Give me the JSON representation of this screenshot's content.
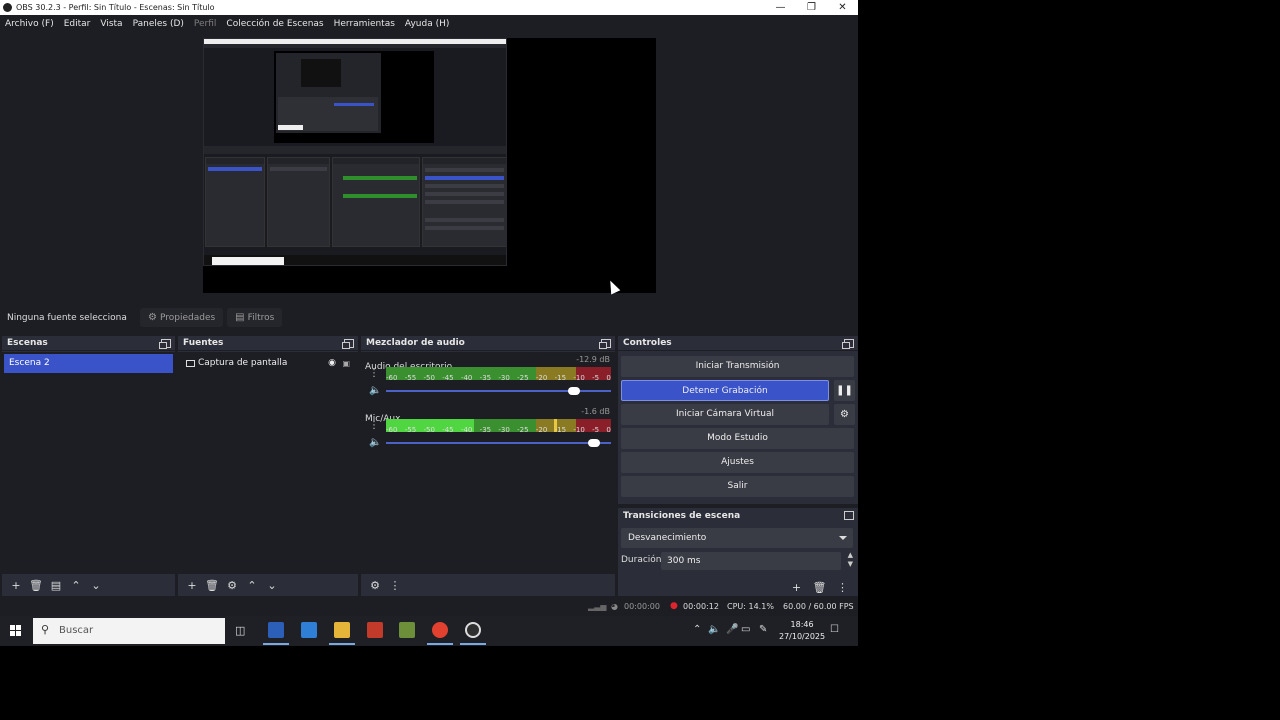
{
  "window": {
    "title": "OBS 30.2.3 - Perfil: Sin Título - Escenas: Sin Título"
  },
  "menu": [
    "Archivo (F)",
    "Editar",
    "Vista",
    "Paneles (D)",
    "Perfil",
    "Colección de Escenas",
    "Herramientas",
    "Ayuda (H)"
  ],
  "source_toolbar": {
    "no_selection": "Ninguna fuente selecciona",
    "properties": "Propiedades",
    "filters": "Filtros"
  },
  "scenes": {
    "title": "Escenas",
    "items": [
      "Escena 2"
    ]
  },
  "sources": {
    "title": "Fuentes",
    "items": [
      "Captura de pantalla"
    ]
  },
  "mixer": {
    "title": "Mezclador de audio",
    "ticks": [
      "-60",
      "-55",
      "-50",
      "-45",
      "-40",
      "-35",
      "-30",
      "-25",
      "-20",
      "-15",
      "-10",
      "-5",
      "0"
    ],
    "channels": [
      {
        "name": "Audio del escritorio",
        "db": "-12.9 dB",
        "volume": 0.86
      },
      {
        "name": "Mic/Aux",
        "db": "-1.6 dB",
        "volume": 0.95
      }
    ]
  },
  "controls": {
    "title": "Controles",
    "start_stream": "Iniciar Transmisión",
    "stop_recording": "Detener Grabación",
    "start_virtual_cam": "Iniciar Cámara Virtual",
    "studio_mode": "Modo Estudio",
    "settings": "Ajustes",
    "exit": "Salir"
  },
  "transitions": {
    "title": "Transiciones de escena",
    "selected": "Desvanecimiento",
    "duration_label": "Duración",
    "duration_value": "300 ms"
  },
  "status": {
    "stream_time": "00:00:00",
    "rec_time": "00:00:12",
    "cpu": "CPU: 14.1%",
    "fps": "60.00 / 60.00 FPS"
  },
  "taskbar": {
    "search_placeholder": "Buscar",
    "time": "18:46",
    "date": "27/10/2025"
  },
  "colors": {
    "accent": "#3a53c8",
    "panel": "#2b2e38",
    "background": "#1d1e23",
    "meter_green": "#3a8f2e",
    "meter_yellow": "#8a7a22",
    "meter_red": "#8a1f2a"
  }
}
